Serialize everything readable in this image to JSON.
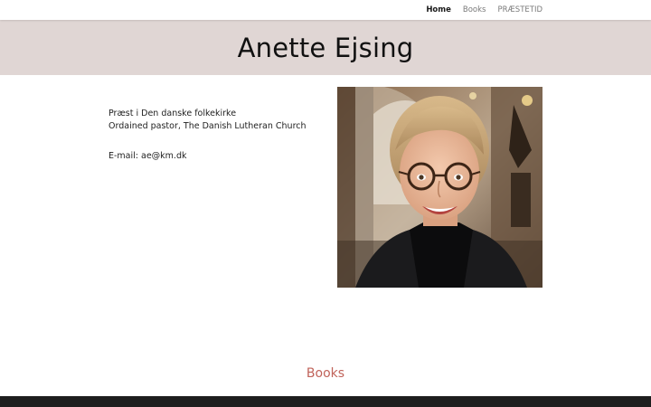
{
  "nav": {
    "items": [
      {
        "label": "Home",
        "active": true
      },
      {
        "label": "Books",
        "active": false
      },
      {
        "label": "PRÆSTETID",
        "active": false
      }
    ]
  },
  "hero": {
    "title": "Anette Ejsing",
    "background": "#e0d6d4"
  },
  "intro": {
    "line1": "Præst i Den danske folkekirke",
    "line2": "Ordained pastor, The Danish Lutheran Church",
    "email": "E-mail: ae@km.dk"
  },
  "portrait": {
    "icon": "portrait-photo"
  },
  "books": {
    "heading": "Books",
    "color": "#c0635a"
  },
  "footer": {
    "background": "#1e1e1e"
  }
}
